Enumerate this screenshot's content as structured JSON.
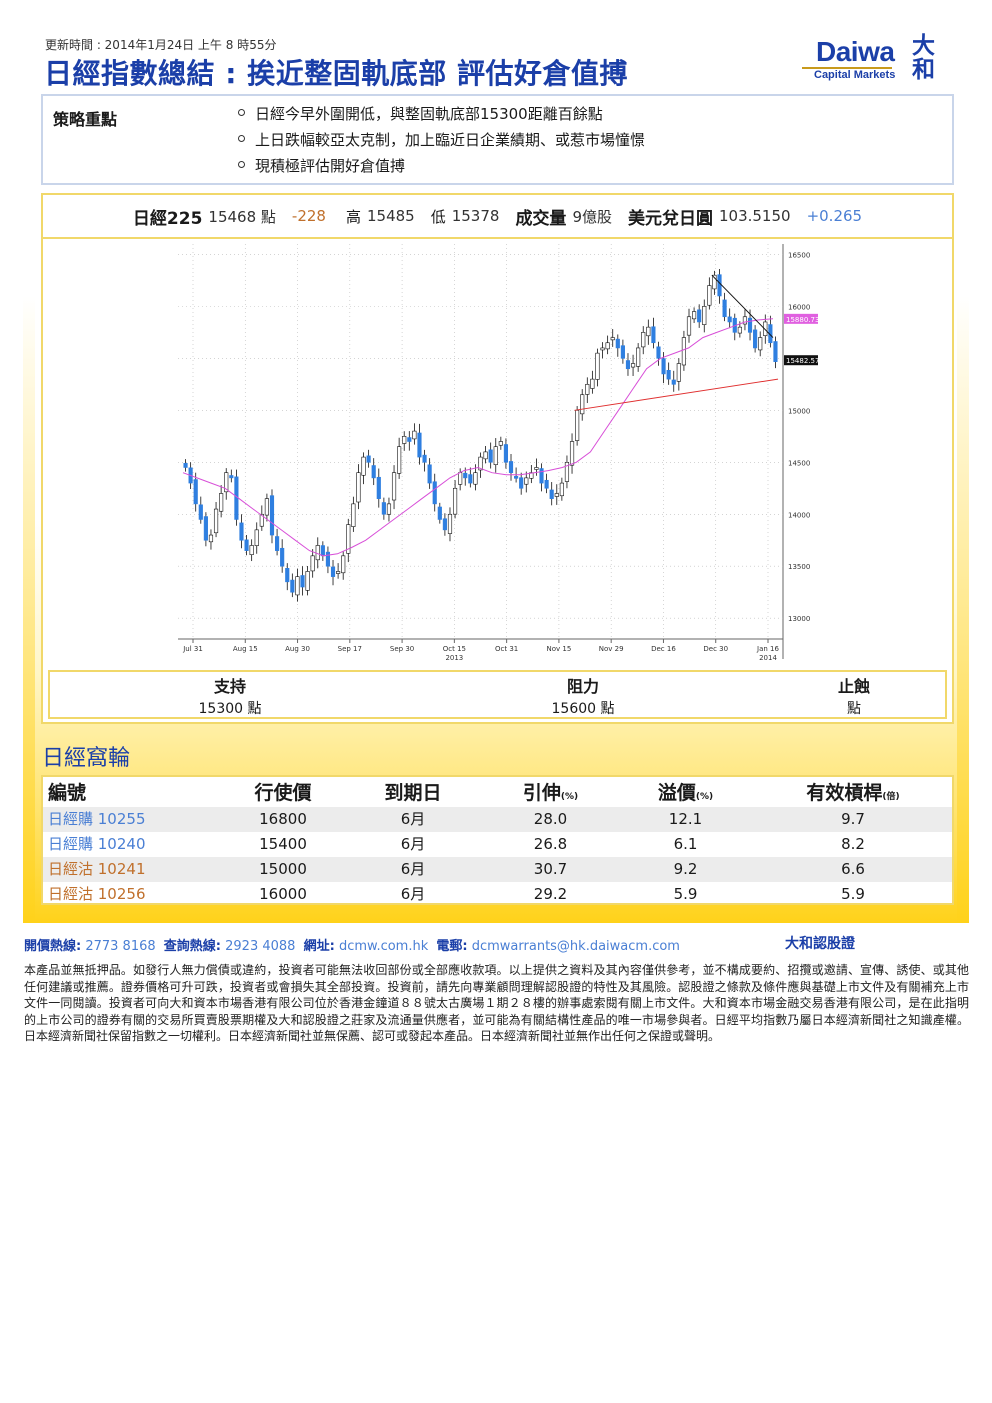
{
  "header": {
    "update_time": "更新時間 : 2014年1月24日 上午 8 時55分",
    "headline": "日經指數總結 : 挨近整固軌底部 評估好倉值搏"
  },
  "logo": {
    "word": "Daiwa",
    "sub": "Capital Markets",
    "kanji_top": "大",
    "kanji_bottom": "和"
  },
  "strategy": {
    "title": "策略重點",
    "points": [
      "日經今早外圍開低，與整固軌底部15300距離百餘點",
      "上日跌幅較亞太克制，加上臨近日企業績期、或惹市場憧憬",
      "現積極評估開好倉值搏"
    ]
  },
  "quote": {
    "index_label": "日經225",
    "index_value": "15468 點",
    "index_change": "-228",
    "high_label": "高",
    "high_value": "15485",
    "low_label": "低",
    "low_value": "15378",
    "volume_label": "成交量",
    "volume_value": "9億股",
    "fx_label": "美元兌日圓",
    "fx_value": "103.5150",
    "fx_change": "+0.265"
  },
  "chart_data": {
    "type": "candlestick",
    "title": "",
    "xlabel": "",
    "ylabel": "",
    "ylim": [
      12800,
      16600
    ],
    "y_ticks": [
      "16500",
      "16000",
      "15500",
      "15000",
      "14500",
      "14000",
      "13500",
      "13000"
    ],
    "x_ticks": [
      "Jul 31",
      "Aug 15",
      "Aug 30",
      "Sep 17",
      "Sep 30",
      "Oct 15",
      "Oct 31",
      "Nov 15",
      "Nov 29",
      "Dec 16",
      "Dec 30",
      "Jan 16"
    ],
    "year_labels": [
      "2013",
      "2014"
    ],
    "price_tags": [
      "15880.73",
      "15482.57"
    ],
    "close": [
      14450,
      14300,
      14100,
      13950,
      13750,
      13800,
      14050,
      14200,
      14400,
      14350,
      13950,
      13750,
      13650,
      13700,
      13850,
      14000,
      14150,
      13800,
      13650,
      13500,
      13350,
      13250,
      13400,
      13300,
      13450,
      13600,
      13700,
      13600,
      13500,
      13400,
      13450,
      13600,
      13900,
      14100,
      14400,
      14550,
      14500,
      14350,
      14150,
      14000,
      14100,
      14400,
      14650,
      14750,
      14700,
      14800,
      14550,
      14500,
      14300,
      14100,
      13950,
      13850,
      14000,
      14250,
      14400,
      14350,
      14300,
      14400,
      14550,
      14600,
      14500,
      14650,
      14700,
      14500,
      14400,
      14350,
      14250,
      14350,
      14400,
      14450,
      14300,
      14250,
      14150,
      14200,
      14300,
      14500,
      14700,
      15000,
      15150,
      15250,
      15300,
      15550,
      15600,
      15650,
      15700,
      15600,
      15500,
      15400,
      15450,
      15600,
      15750,
      15800,
      15650,
      15500,
      15350,
      15300,
      15250,
      15450,
      15700,
      15900,
      15950,
      15850,
      16000,
      16200,
      16300,
      16100,
      15900,
      15850,
      15750,
      15800,
      15900,
      15750,
      15600,
      15700,
      15850,
      15650,
      15468
    ],
    "ma_line": [
      14400,
      14350,
      14300,
      14250,
      14150,
      14050,
      13950,
      13850,
      13750,
      13650,
      13600,
      13620,
      13680,
      13750,
      13850,
      13950,
      14050,
      14150,
      14250,
      14350,
      14420,
      14450,
      14400,
      14380,
      14380,
      14400,
      14420,
      14450,
      14500,
      14600,
      14800,
      15000,
      15200,
      15400,
      15500,
      15550,
      15600,
      15700,
      15750,
      15800,
      15850,
      15870,
      15880
    ],
    "support_line": [
      15000,
      15300
    ],
    "resistance_line": [
      16300,
      15700
    ]
  },
  "levels": {
    "support_label": "支持",
    "support_value": "15300 點",
    "resistance_label": "阻力",
    "resistance_value": "15600 點",
    "stoploss_label": "止蝕",
    "stoploss_value": "點"
  },
  "warrants": {
    "title": "日經窩輪",
    "headers": {
      "code": "編號",
      "strike": "行使價",
      "expiry": "到期日",
      "gearing": "引伸",
      "gearing_unit": "(%)",
      "premium": "溢價",
      "premium_unit": "(%)",
      "eff_gearing": "有效槓桿",
      "eff_gearing_unit": "(倍)"
    },
    "rows": [
      {
        "code": "日經購 10255",
        "strike": "16800",
        "expiry": "6月",
        "gearing": "28.0",
        "premium": "12.1",
        "eff": "9.7",
        "kind": "call"
      },
      {
        "code": "日經購 10240",
        "strike": "15400",
        "expiry": "6月",
        "gearing": "26.8",
        "premium": "6.1",
        "eff": "8.2",
        "kind": "call"
      },
      {
        "code": "日經沽 10241",
        "strike": "15000",
        "expiry": "6月",
        "gearing": "30.7",
        "premium": "9.2",
        "eff": "6.6",
        "kind": "put"
      },
      {
        "code": "日經沽 10256",
        "strike": "16000",
        "expiry": "6月",
        "gearing": "29.2",
        "premium": "5.9",
        "eff": "5.9",
        "kind": "put"
      }
    ]
  },
  "footer": {
    "hotline_label": "開價熱線:",
    "hotline_value": "2773 8168",
    "enquiry_label": "查詢熱線:",
    "enquiry_value": "2923 4088",
    "website_label": "網址:",
    "website_value": "dcmw.com.hk",
    "email_label": "電郵:",
    "email_value": "dcmwarrants@hk.daiwacm.com",
    "brand": "大和認股證",
    "brand_note": ""
  },
  "disclaimer": "本產品並無抵押品。如發行人無力償債或違約，投資者可能無法收回部份或全部應收款項。以上提供之資料及其內容僅供參考，並不構成要約、招攬或邀請、宣傳、誘使、或其他任何建議或推薦。證券價格可升可跌，投資者或會損失其全部投資。投資前，請先向專業顧問理解認股證的特性及其風險。認股證之條款及條件應與基礎上市文件及有關補充上市文件一同閱讀。投資者可向大和資本市場香港有限公司位於香港金鐘道８８號太古廣場１期２８樓的辦事處索閱有關上市文件。大和資本市場金融交易香港有限公司，是在此指明的上市公司的證券有關的交易所買賣股票期權及大和認股證之莊家及流通量供應者，並可能為有關結構性產品的唯一市場參與者。日經平均指數乃屬日本經濟新聞社之知識產權。日本經濟新聞社保留指數之一切權利。日本經濟新聞社並無保薦、認可或發起本產品。日本經濟新聞社並無作出任何之保證或聲明。"
}
